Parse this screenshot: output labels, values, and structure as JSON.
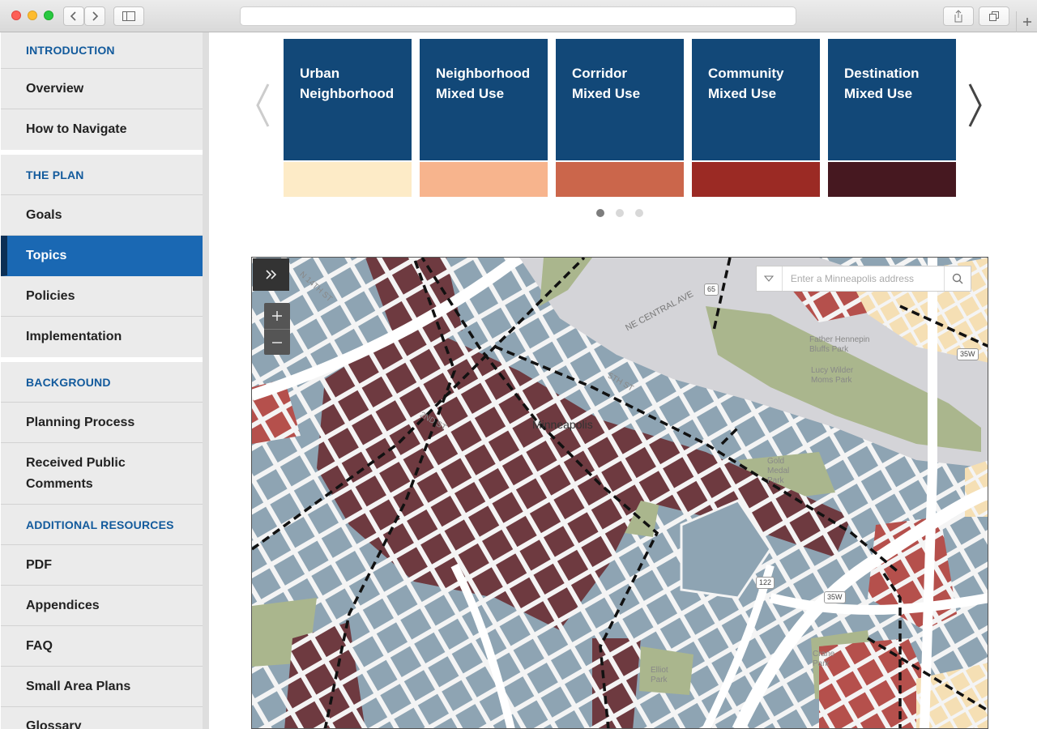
{
  "sidebar": {
    "items": [
      {
        "label": "INTRODUCTION",
        "kind": "section"
      },
      {
        "label": "Overview",
        "kind": "link"
      },
      {
        "label": "How to Navigate",
        "kind": "link"
      },
      {
        "label": "THE PLAN",
        "kind": "section"
      },
      {
        "label": "Goals",
        "kind": "link"
      },
      {
        "label": "Topics",
        "kind": "link",
        "active": true
      },
      {
        "label": "Policies",
        "kind": "link"
      },
      {
        "label": "Implementation",
        "kind": "link"
      },
      {
        "label": "BACKGROUND",
        "kind": "section"
      },
      {
        "label": "Planning Process",
        "kind": "link"
      },
      {
        "label": "Received Public Comments",
        "kind": "link"
      },
      {
        "label": "ADDITIONAL RESOURCES",
        "kind": "section"
      },
      {
        "label": "PDF",
        "kind": "link"
      },
      {
        "label": "Appendices",
        "kind": "link"
      },
      {
        "label": "FAQ",
        "kind": "link"
      },
      {
        "label": "Small Area Plans",
        "kind": "link"
      },
      {
        "label": "Glossary",
        "kind": "link"
      }
    ]
  },
  "carousel": {
    "cards": [
      {
        "line1": "Urban",
        "line2": "Neighborhood",
        "swatch": "#fdebc7"
      },
      {
        "line1": "Neighborhood",
        "line2": "Mixed Use",
        "swatch": "#f7b48d"
      },
      {
        "line1": "Corridor",
        "line2": "Mixed Use",
        "swatch": "#cb664b"
      },
      {
        "line1": "Community",
        "line2": "Mixed Use",
        "swatch": "#9b2a24"
      },
      {
        "line1": "Destination",
        "line2": "Mixed Use",
        "swatch": "#461820"
      }
    ],
    "card_color": "#124878",
    "page_count": 3,
    "current_page": 1
  },
  "map": {
    "search": {
      "placeholder": "Enter a Minneapolis address"
    },
    "city_label": "Minneapolis",
    "street_labels": [
      "N 14TH ST",
      "NE CENTRAL AVE",
      "5TH ST",
      "2ND ST"
    ],
    "park_labels": [
      "Father Hennepin Bluffs Park",
      "Lucy Wilder Moms Park",
      "Gold Medal Park",
      "Elliot Park",
      "Crane Park"
    ],
    "highway_shields": [
      "65",
      "35W",
      "122",
      "35W"
    ],
    "colors": {
      "urban_neighborhood": "#8ea4b3",
      "destination_mixed_use": "#6e3a40",
      "community_mixed_use": "#b5504c",
      "park": "#aab68d",
      "water": "#d4d4d8"
    }
  }
}
